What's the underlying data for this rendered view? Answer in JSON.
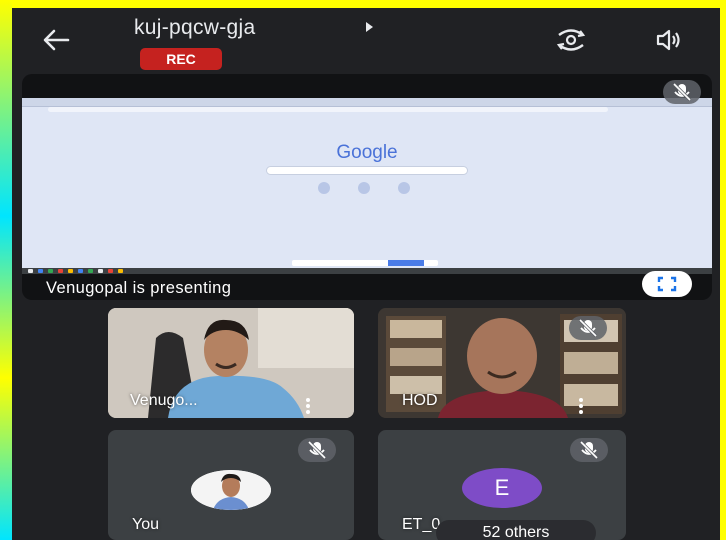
{
  "header": {
    "meeting_code": "kuj-pqcw-gja",
    "recording_badge": "REC",
    "icons": {
      "back": "arrow-left-icon",
      "camera_switch": "camera-switch-icon",
      "audio": "speaker-icon"
    }
  },
  "presentation": {
    "shared_screen": {
      "logo_text": "Google"
    },
    "presenter_label": "Venugopal is presenting",
    "icons": {
      "muted": "mic-off-icon",
      "fullscreen": "fullscreen-icon"
    }
  },
  "participants": [
    {
      "name": "Venugo...",
      "has_video": true,
      "muted": false
    },
    {
      "name": "HOD",
      "has_video": true,
      "muted": true
    },
    {
      "name": "You",
      "has_video": false,
      "muted": true
    },
    {
      "name": "ET_0",
      "avatar_letter": "E",
      "has_video": false,
      "muted": true,
      "others_label": "52 others"
    }
  ],
  "colors": {
    "background": "#202124",
    "tile": "#3c4043",
    "rec_badge": "#c5221f",
    "avatar_e": "#7e4cc7"
  }
}
